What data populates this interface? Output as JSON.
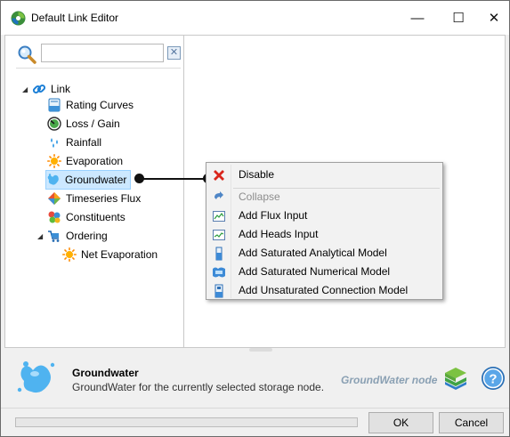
{
  "window": {
    "title": "Default Link Editor",
    "controls": {
      "minimize": "—",
      "maximize": "☐",
      "close": "✕"
    }
  },
  "search": {
    "value": "",
    "placeholder": "",
    "clear_glyph": "✕"
  },
  "tree": {
    "root": {
      "label": "Link",
      "icon": "link-icon"
    },
    "items": [
      {
        "label": "Rating Curves",
        "icon": "rating-curves-icon"
      },
      {
        "label": "Loss / Gain",
        "icon": "loss-gain-icon"
      },
      {
        "label": "Rainfall",
        "icon": "rainfall-icon"
      },
      {
        "label": "Evaporation",
        "icon": "evaporation-icon"
      },
      {
        "label": "Groundwater",
        "icon": "groundwater-icon",
        "selected": true
      },
      {
        "label": "Timeseries Flux",
        "icon": "timeseries-flux-icon"
      },
      {
        "label": "Constituents",
        "icon": "constituents-icon"
      },
      {
        "label": "Ordering",
        "icon": "ordering-icon"
      }
    ],
    "ordering_children": [
      {
        "label": "Net Evaporation",
        "icon": "net-evaporation-icon"
      }
    ]
  },
  "context_menu": {
    "items": [
      {
        "label": "Disable",
        "icon": "disable-x-icon",
        "enabled": true
      },
      {
        "label": "Collapse",
        "icon": "collapse-icon",
        "enabled": false
      },
      {
        "label": "Add Flux Input",
        "icon": "flux-input-icon",
        "enabled": true
      },
      {
        "label": "Add Heads Input",
        "icon": "heads-input-icon",
        "enabled": true
      },
      {
        "label": "Add Saturated Analytical Model",
        "icon": "analytical-model-icon",
        "enabled": true
      },
      {
        "label": "Add Saturated Numerical Model",
        "icon": "numerical-model-icon",
        "enabled": true
      },
      {
        "label": "Add Unsaturated Connection Model",
        "icon": "unsaturated-model-icon",
        "enabled": true
      }
    ]
  },
  "info": {
    "title": "Groundwater",
    "description": "GroundWater for the currently selected storage node.",
    "node_label": "GroundWater node"
  },
  "footer": {
    "progress": 0,
    "ok_label": "OK",
    "cancel_label": "Cancel"
  },
  "colors": {
    "accent": "#0078d7",
    "selection": "#cce8ff",
    "disable_red": "#d9261c",
    "link_blue": "#1c7fd6"
  }
}
